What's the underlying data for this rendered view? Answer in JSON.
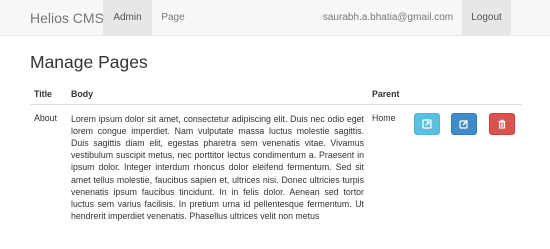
{
  "navbar": {
    "brand": "Helios CMS",
    "links": [
      {
        "label": "Admin",
        "active": true
      },
      {
        "label": "Page",
        "active": false
      }
    ],
    "user_email": "saurabh.a.bhatia@gmail.com",
    "logout_label": "Logout"
  },
  "main": {
    "title": "Manage Pages",
    "table": {
      "headers": [
        "Title",
        "Body",
        "Parent",
        ""
      ],
      "rows": [
        {
          "title": "About",
          "body": "Lorem ipsum dolor sit amet, consectetur adipiscing elit. Duis nec odio eget lorem congue imperdiet. Nam vulputate massa luctus molestie sagittis. Duis sagittis diam elit, egestas pharetra sem venenatis vitae. Vivamus vestibulum suscipit metus, nec porttitor lectus condimentum a. Praesent in ipsum dolor. Integer interdum rhoncus dolor eleifend fermentum. Sed sit amet tellus molestie, faucibus sapien et, ultrices nisi. Donec ultricies turpis venenatis ipsum faucibus tincidunt. In in felis dolor. Aenean sed tortor luctus sem varius facilisis. In pretium urna id pellentesque fermentum. Ut hendrerit imperdiet venenatis. Phasellus ultrices velit non metus",
          "parent": "Home",
          "actions": [
            {
              "icon": "external-link-icon",
              "color": "#5bc0de"
            },
            {
              "icon": "edit-icon",
              "color": "#428bca"
            },
            {
              "icon": "trash-icon",
              "color": "#d9534f"
            }
          ]
        }
      ]
    }
  }
}
